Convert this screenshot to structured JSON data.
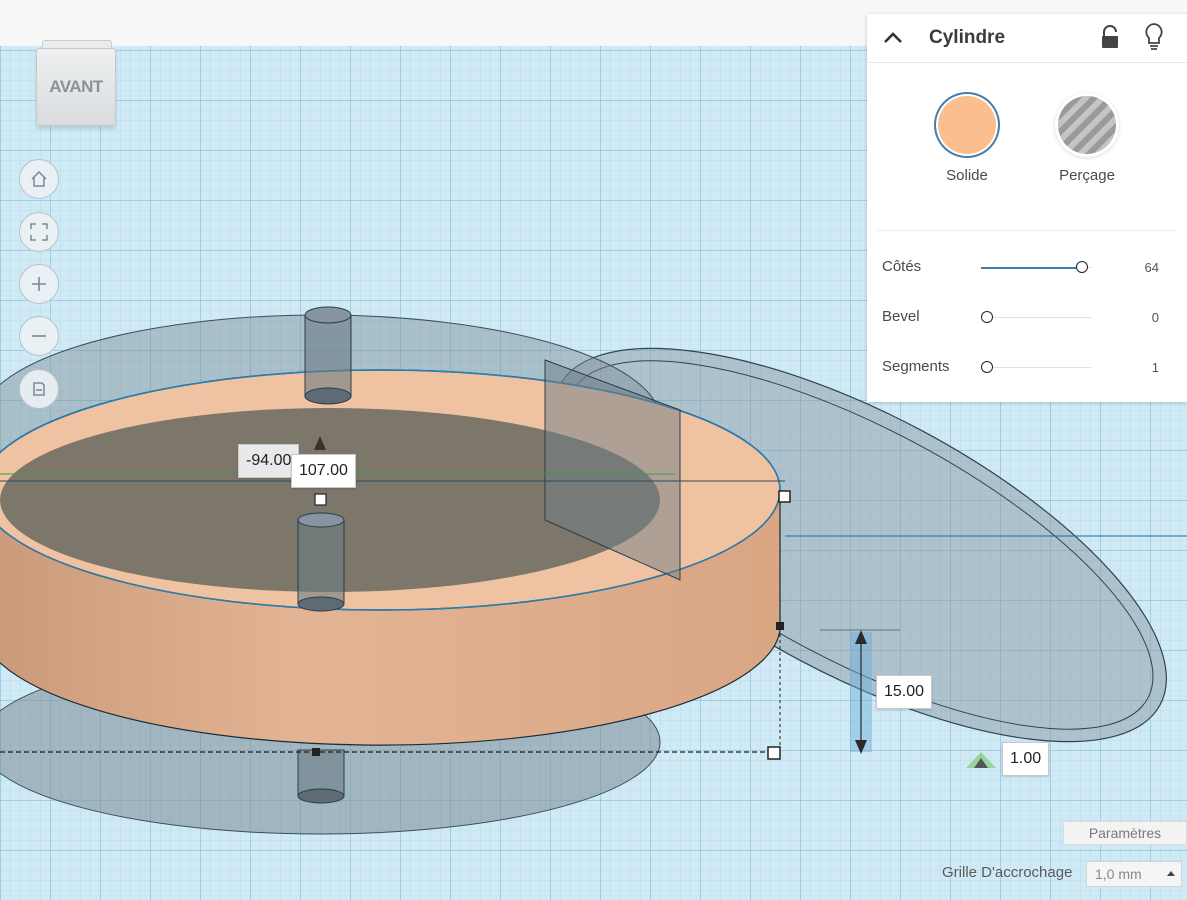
{
  "viewcube": {
    "label": "AVANT"
  },
  "dimensions": {
    "x_offset": "-94.00",
    "length": "107.00",
    "height": "15.00",
    "elevation": "1.00"
  },
  "inspector": {
    "title": "Cylindre",
    "solid_label": "Solide",
    "hole_label": "Perçage",
    "solid_color": "#fbbf8f",
    "properties": [
      {
        "label": "Côtés",
        "value": "64",
        "fraction": 0.97
      },
      {
        "label": "Bevel",
        "value": "0",
        "fraction": 0.0
      },
      {
        "label": "Segments",
        "value": "1",
        "fraction": 0.0
      }
    ]
  },
  "bottom": {
    "params_label": "Paramètres",
    "snap_label": "Grille D'accrochage",
    "snap_value": "1,0 mm"
  },
  "icons": [
    "home-icon",
    "fit-view-icon",
    "zoom-in-icon",
    "zoom-out-icon",
    "perspective-icon",
    "lock-icon",
    "lightbulb-icon",
    "chevron-up-icon"
  ]
}
